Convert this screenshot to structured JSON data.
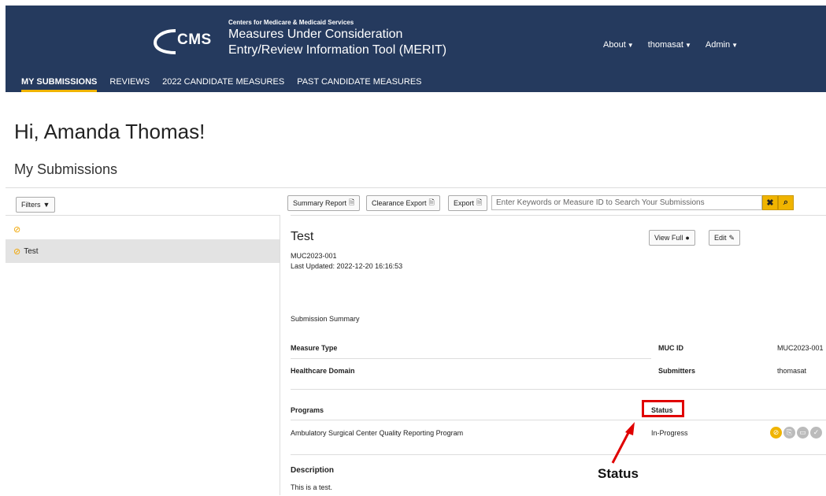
{
  "header": {
    "agency": "Centers for Medicare & Medicaid Services",
    "logo_text": "CMS",
    "title_line1": "Measures Under Consideration",
    "title_line2": "Entry/Review Information Tool (MERIT)",
    "menu": [
      {
        "label": "About"
      },
      {
        "label": "thomasat"
      },
      {
        "label": "Admin"
      }
    ]
  },
  "nav": {
    "tabs": [
      {
        "label": "MY SUBMISSIONS",
        "active": true
      },
      {
        "label": "REVIEWS"
      },
      {
        "label": "2022 CANDIDATE MEASURES"
      },
      {
        "label": "PAST CANDIDATE MEASURES"
      }
    ]
  },
  "greeting": "Hi, Amanda Thomas!",
  "section_title": "My Submissions",
  "toolbar": {
    "filters_label": "Filters",
    "summary_report": "Summary Report",
    "clearance_export": "Clearance Export",
    "export": "Export",
    "search_placeholder": "Enter Keywords or Measure ID to Search Your Submissions"
  },
  "list": {
    "items": [
      {
        "label": "Test"
      }
    ]
  },
  "detail": {
    "title": "Test",
    "id": "MUC2023-001",
    "last_updated": "Last Updated: 2022-12-20 16:16:53",
    "view_full": "View Full",
    "edit": "Edit",
    "section": "Submission Summary",
    "measure_type_label": "Measure Type",
    "muc_id_label": "MUC ID",
    "muc_id_value": "MUC2023-001",
    "healthcare_domain_label": "Healthcare Domain",
    "submitters_label": "Submitters",
    "submitters_value": "thomasat",
    "programs_label": "Programs",
    "status_label": "Status",
    "program_value": "Ambulatory Surgical Center Quality Reporting Program",
    "status_value": "In-Progress",
    "description_label": "Description",
    "description_value": "This is a test."
  },
  "annotation": {
    "label": "Status",
    "color": "#e00000"
  },
  "colors": {
    "header_bg": "#253a5e",
    "accent": "#f0b400"
  }
}
